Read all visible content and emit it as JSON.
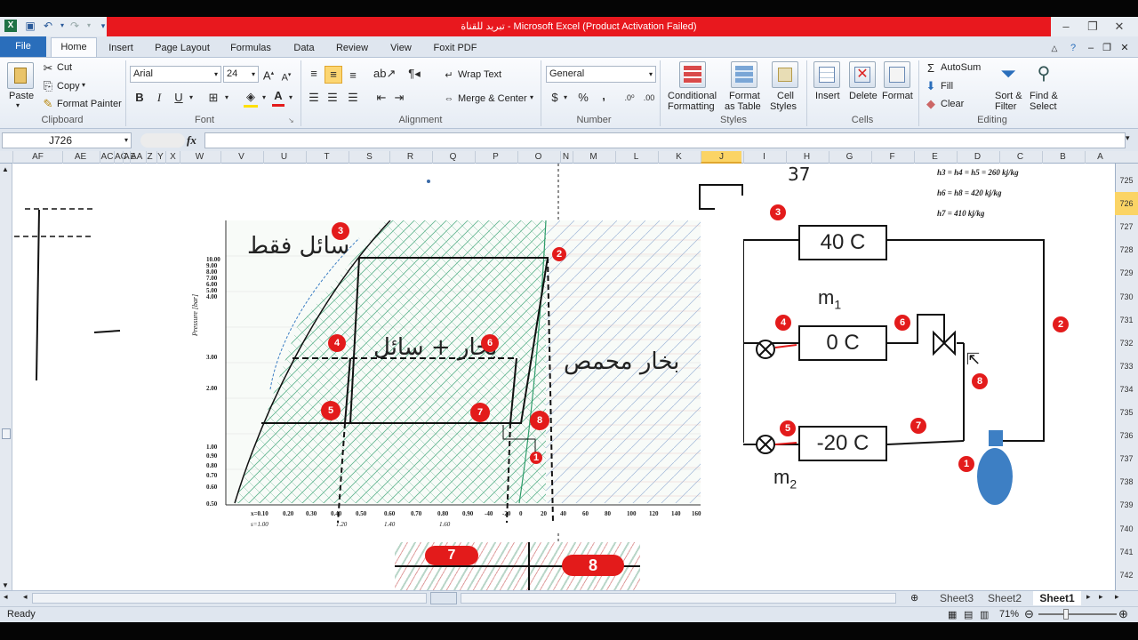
{
  "window": {
    "title": "تبريد للقناة  -  Microsoft Excel (Product Activation Failed)"
  },
  "ribbon_tabs": [
    "File",
    "Home",
    "Insert",
    "Page Layout",
    "Formulas",
    "Data",
    "Review",
    "View",
    "Foxit PDF"
  ],
  "clipboard": {
    "paste": "Paste",
    "cut": "Cut",
    "copy": "Copy",
    "format_painter": "Format Painter",
    "label": "Clipboard"
  },
  "font": {
    "name": "Arial",
    "size": "24",
    "bold": "B",
    "italic": "I",
    "underline": "U",
    "label": "Font"
  },
  "alignment": {
    "wrap": "Wrap Text",
    "merge": "Merge & Center",
    "label": "Alignment"
  },
  "number": {
    "format": "General",
    "label": "Number",
    "currency": "$",
    "percent": "%",
    "comma": ","
  },
  "styles": {
    "conditional": "Conditional",
    "conditional2": "Formatting",
    "format_table": "Format",
    "format_table2": "as Table",
    "cell_styles": "Cell",
    "cell_styles2": "Styles",
    "label": "Styles"
  },
  "cells": {
    "insert": "Insert",
    "delete": "Delete",
    "format": "Format",
    "label": "Cells"
  },
  "editing": {
    "autosum": "AutoSum",
    "fill": "Fill",
    "clear": "Clear",
    "sort": "Sort &",
    "sort2": "Filter",
    "find": "Find &",
    "find2": "Select",
    "label": "Editing"
  },
  "formula_bar": {
    "name_box": "J726",
    "fx": "fx",
    "value": ""
  },
  "columns": [
    "AF",
    "AE",
    "AC",
    "AC",
    "AE",
    "AA",
    "Z",
    "Y",
    "X",
    "W",
    "V",
    "U",
    "T",
    "S",
    "R",
    "Q",
    "P",
    "O",
    "N",
    "M",
    "L",
    "K",
    "J",
    "I",
    "H",
    "G",
    "F",
    "E",
    "D",
    "C",
    "B",
    "A"
  ],
  "rows": [
    "725",
    "726",
    "727",
    "728",
    "729",
    "730",
    "731",
    "732",
    "733",
    "734",
    "735",
    "736",
    "737",
    "738",
    "739",
    "740",
    "741",
    "742"
  ],
  "selected_row": "726",
  "selected_col": "J",
  "sheet_content": {
    "number_37": "37",
    "enthalpy1": "h3 = h4 = h5 = 260    kj/kg",
    "enthalpy2": "h6 = h8 = 420    kj/kg",
    "enthalpy3": "h7 = 410    kj/kg",
    "ph_chart": {
      "label_liquid": "سائل فقط",
      "label_mix": "بخار + سائل",
      "label_vapor": "بخار محمص",
      "yaxis": "Pressure [bar]",
      "ytick_labels": [
        "10.00",
        "9.00",
        "8.00",
        "7.00",
        "6.00",
        "5.00",
        "4.00",
        "3.00",
        "2.00",
        "1.00",
        "0.90",
        "0.80",
        "0.70",
        "0.60",
        "0.50"
      ],
      "xtick_labels": [
        "x=0.10",
        "0.20",
        "0.30",
        "0.40",
        "0.50",
        "0.60",
        "0.70",
        "0.80",
        "0.90",
        "-40",
        "-20",
        "0",
        "20",
        "40",
        "60",
        "80",
        "100",
        "120",
        "140",
        "160"
      ],
      "xtick_extra": [
        "s=1.00",
        "1.20",
        "1.40",
        "1.60"
      ],
      "points": [
        "1",
        "2",
        "3",
        "4",
        "5",
        "6",
        "7",
        "8"
      ]
    },
    "schematic": {
      "box_top": "40 C",
      "box_mid": "0 C",
      "box_bot": "-20 C",
      "m1": "m",
      "m1_sub": "1",
      "m2": "m",
      "m2_sub": "2",
      "points": [
        "3",
        "4",
        "6",
        "2",
        "8",
        "5",
        "7",
        "1"
      ]
    },
    "crop_points": [
      "7",
      "8"
    ]
  },
  "sheet_tabs": [
    "Sheet3",
    "Sheet2",
    "Sheet1"
  ],
  "active_sheet": "Sheet1",
  "status": {
    "ready": "Ready",
    "zoom": "71%"
  },
  "colors": {
    "title_red": "#e8181e",
    "file_blue": "#2a6ebb",
    "chart_green": "#2e9c6a",
    "point_red": "#e31b1b",
    "pump_blue": "#3d7fc4"
  }
}
